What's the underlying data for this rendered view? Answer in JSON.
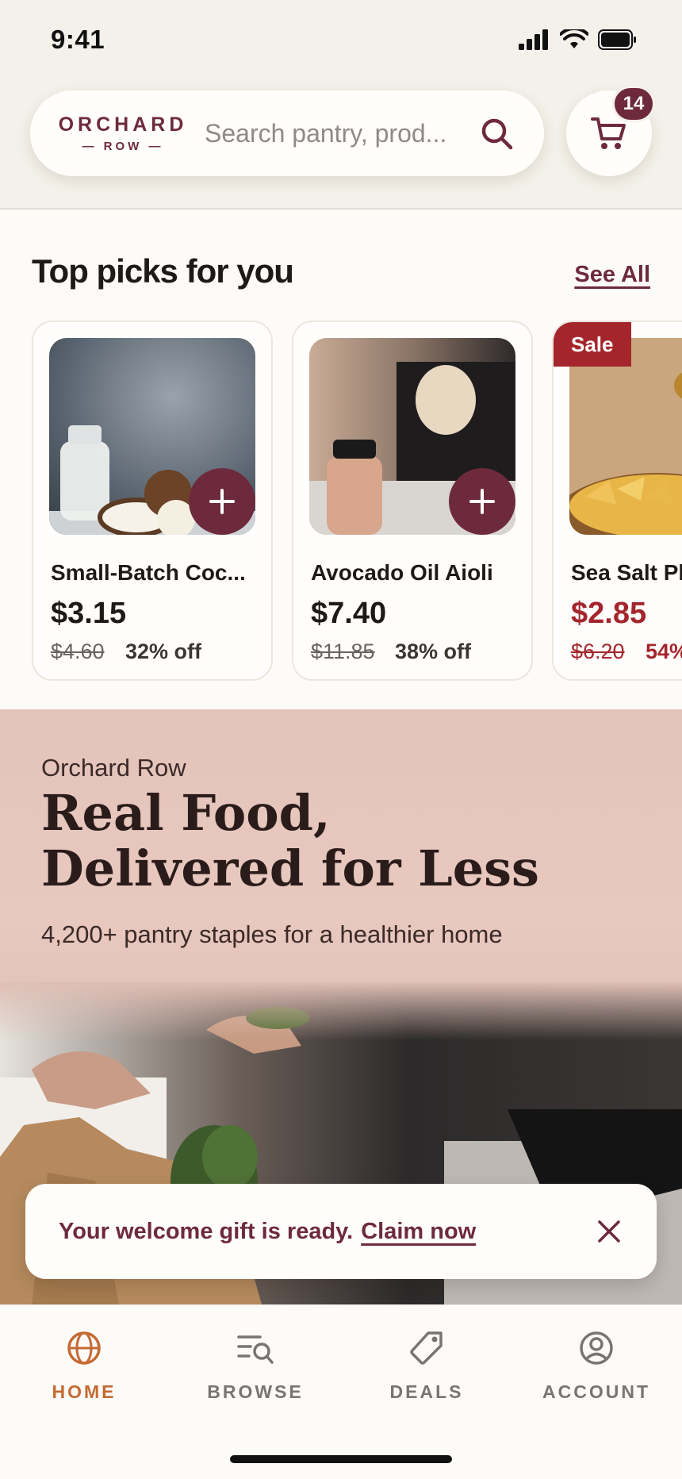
{
  "status_bar": {
    "time": "9:41"
  },
  "header": {
    "logo_top": "ORCHARD",
    "logo_bottom": "— ROW —",
    "search_placeholder": "Search pantry, prod...",
    "cart_count": "14"
  },
  "top_picks": {
    "title": "Top picks for you",
    "see_all": "See All",
    "products": [
      {
        "name": "Small-Batch Coc...",
        "price": "$3.15",
        "was": "$4.60",
        "off": "32% off",
        "sale": false
      },
      {
        "name": "Avocado Oil Aioli",
        "price": "$7.40",
        "was": "$11.85",
        "off": "38% off",
        "sale": false
      },
      {
        "name": "Sea Salt Pl",
        "price": "$2.85",
        "was": "$6.20",
        "off": "54%",
        "sale": true,
        "badge": "Sale"
      }
    ]
  },
  "hero": {
    "brand": "Orchard Row",
    "title_line1": "Real Food,",
    "title_line2": "Delivered for Less",
    "subtitle": "4,200+ pantry staples for a healthier home"
  },
  "toast": {
    "text": "Your welcome gift is ready.",
    "link": "Claim now"
  },
  "tabbar": {
    "tabs": [
      {
        "label": "HOME",
        "icon": "globe-icon",
        "active": true
      },
      {
        "label": "BROWSE",
        "icon": "browse-search-icon",
        "active": false
      },
      {
        "label": "DEALS",
        "icon": "tag-icon",
        "active": false
      },
      {
        "label": "ACCOUNT",
        "icon": "account-icon",
        "active": false
      }
    ]
  },
  "colors": {
    "brand": "#6e2a3d",
    "accent_active_tab": "#c56a33",
    "sale": "#a4262c",
    "background": "#f4f1ea"
  }
}
